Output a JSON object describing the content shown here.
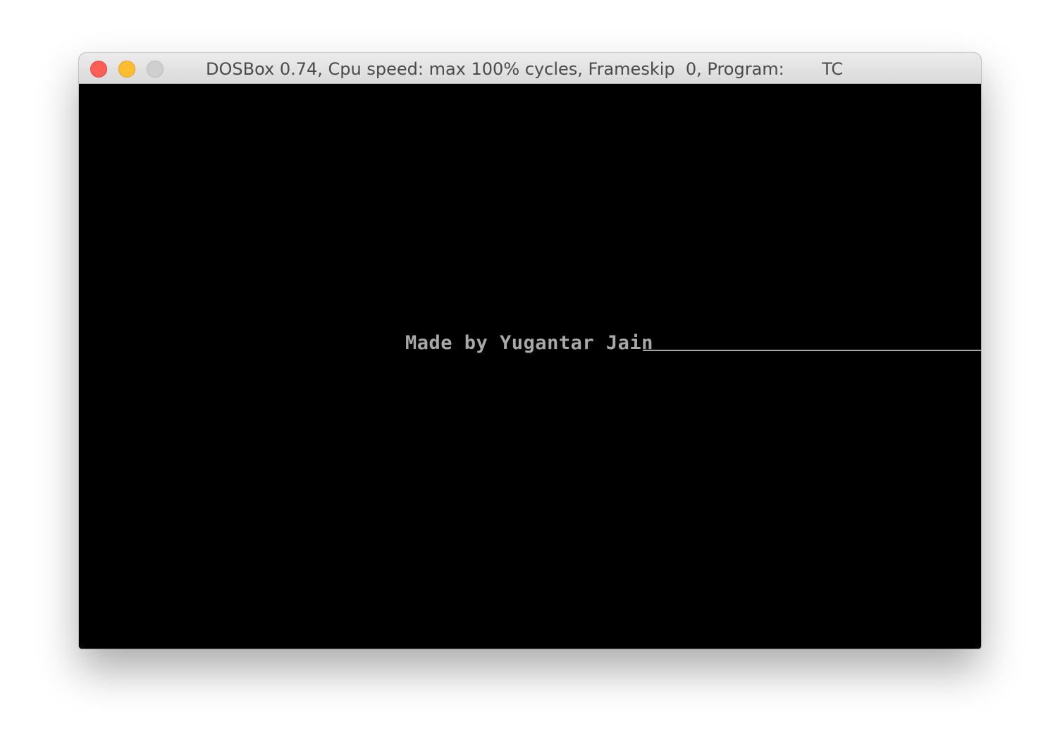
{
  "window": {
    "title": "DOSBox 0.74, Cpu speed: max 100% cycles, Frameskip  0, Program:       TC"
  },
  "screen": {
    "text": "Made by Yugantar Jain",
    "text_color": "#a8a8a8",
    "background_color": "#000000"
  },
  "controls": {
    "close_color": "#fd5f57",
    "minimize_color": "#febc2e",
    "zoom_color": "#cfcfcf"
  }
}
